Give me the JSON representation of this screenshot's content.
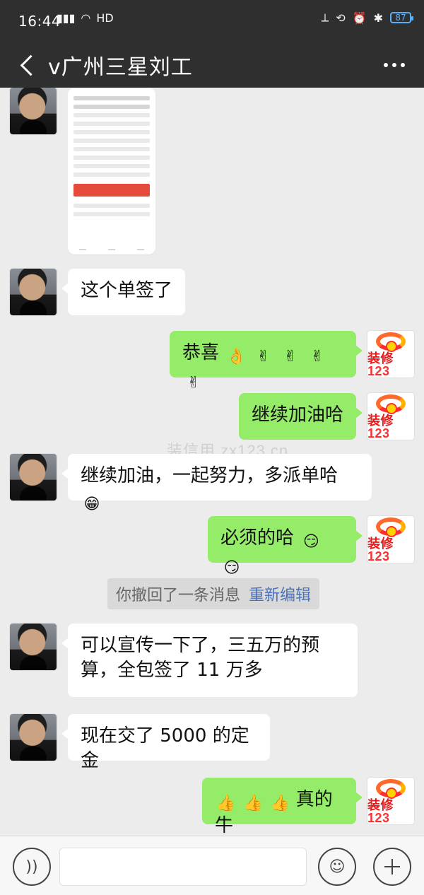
{
  "status_bar": {
    "time": "16:44",
    "left_icons": [
      "signal-icon",
      "wifi-icon",
      "hd-icon"
    ],
    "right_icons": [
      "nfc-icon",
      "lock-icon",
      "alarm-icon",
      "bluetooth-icon"
    ],
    "battery": "87"
  },
  "header": {
    "title": "v广州三星刘工",
    "back_icon": "chevron-left-icon",
    "more_icon": "more-icon"
  },
  "watermark": "装信用 zx123.cn",
  "messages": [
    {
      "side": "in",
      "type": "image",
      "avatar": "contact-avatar",
      "text": ""
    },
    {
      "side": "in",
      "type": "text",
      "avatar": "contact-avatar",
      "text": "这个单签了"
    },
    {
      "side": "out",
      "type": "text",
      "avatar": "brand-avatar",
      "text": "恭喜",
      "emojis": [
        "👌",
        "✌",
        "✌",
        "✌",
        "✌"
      ]
    },
    {
      "side": "out",
      "type": "text",
      "avatar": "brand-avatar",
      "text": "继续加油哈"
    },
    {
      "side": "in",
      "type": "text",
      "avatar": "contact-avatar",
      "text": "继续加油，一起努力，多派单哈",
      "emojis": [
        "😁"
      ]
    },
    {
      "side": "out",
      "type": "text",
      "avatar": "brand-avatar",
      "text": "必须的哈",
      "emojis": [
        "😏",
        "😏"
      ]
    },
    {
      "side": "system",
      "type": "recall",
      "text": "你撤回了一条消息",
      "link": "重新编辑"
    },
    {
      "side": "in",
      "type": "text",
      "avatar": "contact-avatar",
      "text": "可以宣传一下了，三五万的预算，全包签了 11 万多"
    },
    {
      "side": "in",
      "type": "text",
      "avatar": "contact-avatar",
      "text": "现在交了 5000 的定金"
    },
    {
      "side": "out",
      "type": "text",
      "avatar": "brand-avatar",
      "text": "真的牛",
      "emojis": [
        "👍",
        "👍",
        "👍"
      ]
    }
  ],
  "brand_avatar": {
    "cn": "装修",
    "num": "123"
  },
  "input_bar": {
    "voice_icon": "voice-icon",
    "emoji_icon": "emoji-icon",
    "plus_icon": "plus-icon",
    "placeholder": ""
  }
}
